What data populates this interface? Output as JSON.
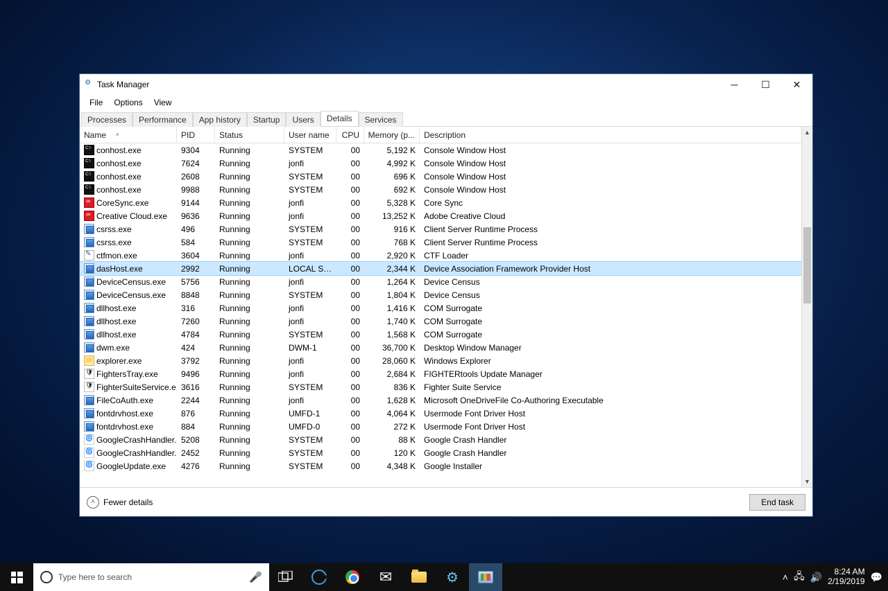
{
  "window": {
    "title": "Task Manager",
    "menus": [
      "File",
      "Options",
      "View"
    ],
    "tabs": [
      "Processes",
      "Performance",
      "App history",
      "Startup",
      "Users",
      "Details",
      "Services"
    ],
    "active_tab": "Details",
    "columns": [
      "Name",
      "PID",
      "Status",
      "User name",
      "CPU",
      "Memory (p...",
      "Description"
    ],
    "footer_fewer": "Fewer details",
    "end_task": "End task"
  },
  "processes": [
    {
      "icon": "console",
      "name": "conhost.exe",
      "pid": "9304",
      "status": "Running",
      "user": "SYSTEM",
      "cpu": "00",
      "mem": "5,192 K",
      "desc": "Console Window Host"
    },
    {
      "icon": "console",
      "name": "conhost.exe",
      "pid": "7624",
      "status": "Running",
      "user": "jonfi",
      "cpu": "00",
      "mem": "4,992 K",
      "desc": "Console Window Host"
    },
    {
      "icon": "console",
      "name": "conhost.exe",
      "pid": "2608",
      "status": "Running",
      "user": "SYSTEM",
      "cpu": "00",
      "mem": "696 K",
      "desc": "Console Window Host"
    },
    {
      "icon": "console",
      "name": "conhost.exe",
      "pid": "9988",
      "status": "Running",
      "user": "SYSTEM",
      "cpu": "00",
      "mem": "692 K",
      "desc": "Console Window Host"
    },
    {
      "icon": "cc",
      "name": "CoreSync.exe",
      "pid": "9144",
      "status": "Running",
      "user": "jonfi",
      "cpu": "00",
      "mem": "5,328 K",
      "desc": "Core Sync"
    },
    {
      "icon": "cc",
      "name": "Creative Cloud.exe",
      "pid": "9636",
      "status": "Running",
      "user": "jonfi",
      "cpu": "00",
      "mem": "13,252 K",
      "desc": "Adobe Creative Cloud"
    },
    {
      "icon": "app",
      "name": "csrss.exe",
      "pid": "496",
      "status": "Running",
      "user": "SYSTEM",
      "cpu": "00",
      "mem": "916 K",
      "desc": "Client Server Runtime Process"
    },
    {
      "icon": "app",
      "name": "csrss.exe",
      "pid": "584",
      "status": "Running",
      "user": "SYSTEM",
      "cpu": "00",
      "mem": "768 K",
      "desc": "Client Server Runtime Process"
    },
    {
      "icon": "pen",
      "name": "ctfmon.exe",
      "pid": "3604",
      "status": "Running",
      "user": "jonfi",
      "cpu": "00",
      "mem": "2,920 K",
      "desc": "CTF Loader"
    },
    {
      "icon": "app",
      "name": "dasHost.exe",
      "pid": "2992",
      "status": "Running",
      "user": "LOCAL SE...",
      "cpu": "00",
      "mem": "2,344 K",
      "desc": "Device Association Framework Provider Host",
      "selected": true
    },
    {
      "icon": "app",
      "name": "DeviceCensus.exe",
      "pid": "5756",
      "status": "Running",
      "user": "jonfi",
      "cpu": "00",
      "mem": "1,264 K",
      "desc": "Device Census"
    },
    {
      "icon": "app",
      "name": "DeviceCensus.exe",
      "pid": "8848",
      "status": "Running",
      "user": "SYSTEM",
      "cpu": "00",
      "mem": "1,804 K",
      "desc": "Device Census"
    },
    {
      "icon": "app",
      "name": "dllhost.exe",
      "pid": "316",
      "status": "Running",
      "user": "jonfi",
      "cpu": "00",
      "mem": "1,416 K",
      "desc": "COM Surrogate"
    },
    {
      "icon": "app",
      "name": "dllhost.exe",
      "pid": "7260",
      "status": "Running",
      "user": "jonfi",
      "cpu": "00",
      "mem": "1,740 K",
      "desc": "COM Surrogate"
    },
    {
      "icon": "app",
      "name": "dllhost.exe",
      "pid": "4784",
      "status": "Running",
      "user": "SYSTEM",
      "cpu": "00",
      "mem": "1,568 K",
      "desc": "COM Surrogate"
    },
    {
      "icon": "app",
      "name": "dwm.exe",
      "pid": "424",
      "status": "Running",
      "user": "DWM-1",
      "cpu": "00",
      "mem": "36,700 K",
      "desc": "Desktop Window Manager"
    },
    {
      "icon": "folder",
      "name": "explorer.exe",
      "pid": "3792",
      "status": "Running",
      "user": "jonfi",
      "cpu": "00",
      "mem": "28,060 K",
      "desc": "Windows Explorer"
    },
    {
      "icon": "shield",
      "name": "FightersTray.exe",
      "pid": "9496",
      "status": "Running",
      "user": "jonfi",
      "cpu": "00",
      "mem": "2,684 K",
      "desc": "FIGHTERtools Update Manager"
    },
    {
      "icon": "shield",
      "name": "FighterSuiteService.e...",
      "pid": "3616",
      "status": "Running",
      "user": "SYSTEM",
      "cpu": "00",
      "mem": "836 K",
      "desc": "Fighter Suite Service"
    },
    {
      "icon": "app",
      "name": "FileCoAuth.exe",
      "pid": "2244",
      "status": "Running",
      "user": "jonfi",
      "cpu": "00",
      "mem": "1,628 K",
      "desc": "Microsoft OneDriveFile Co-Authoring Executable"
    },
    {
      "icon": "app",
      "name": "fontdrvhost.exe",
      "pid": "876",
      "status": "Running",
      "user": "UMFD-1",
      "cpu": "00",
      "mem": "4,064 K",
      "desc": "Usermode Font Driver Host"
    },
    {
      "icon": "app",
      "name": "fontdrvhost.exe",
      "pid": "884",
      "status": "Running",
      "user": "UMFD-0",
      "cpu": "00",
      "mem": "272 K",
      "desc": "Usermode Font Driver Host"
    },
    {
      "icon": "google",
      "name": "GoogleCrashHandler...",
      "pid": "5208",
      "status": "Running",
      "user": "SYSTEM",
      "cpu": "00",
      "mem": "88 K",
      "desc": "Google Crash Handler"
    },
    {
      "icon": "google",
      "name": "GoogleCrashHandler...",
      "pid": "2452",
      "status": "Running",
      "user": "SYSTEM",
      "cpu": "00",
      "mem": "120 K",
      "desc": "Google Crash Handler"
    },
    {
      "icon": "google",
      "name": "GoogleUpdate.exe",
      "pid": "4276",
      "status": "Running",
      "user": "SYSTEM",
      "cpu": "00",
      "mem": "4,348 K",
      "desc": "Google Installer"
    }
  ],
  "taskbar": {
    "search_placeholder": "Type here to search",
    "time": "8:24 AM",
    "date": "2/19/2019"
  }
}
